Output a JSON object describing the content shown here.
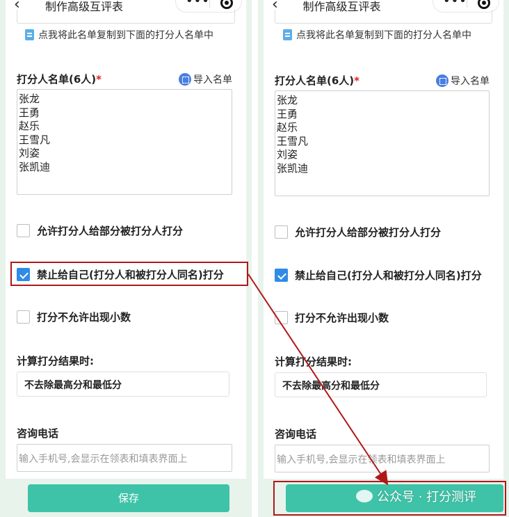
{
  "nav_title": "制作高级互评表",
  "copy_hint": "点我将此名单复制到下面的打分人名单中",
  "raters": {
    "title": "打分人名单(6人)",
    "required_mark": "*",
    "import_label": "导入名单",
    "names": [
      "张龙",
      "王勇",
      "赵乐",
      "王雪凡",
      "刘姿",
      "张凯迪"
    ]
  },
  "options": {
    "allow_partial": {
      "label": "允许打分人给部分被打分人打分",
      "checked": false
    },
    "forbid_self": {
      "label": "禁止给自己(打分人和被打分人同名)打分",
      "checked": true
    },
    "no_decimal": {
      "label": "打分不允许出现小数",
      "checked": false
    }
  },
  "calc": {
    "title": "计算打分结果时:",
    "value": "不去除最高分和最低分"
  },
  "phone": {
    "title": "咨询电话",
    "placeholder": "输入手机号,会显示在领表和填表界面上"
  },
  "save_label": "保存",
  "watermark": "公众号 · 打分测评",
  "colors": {
    "accent_green": "#3ec3a8",
    "checkbox_blue": "#2f8be6",
    "highlight_red": "#b01818",
    "required_red": "#e02020"
  }
}
